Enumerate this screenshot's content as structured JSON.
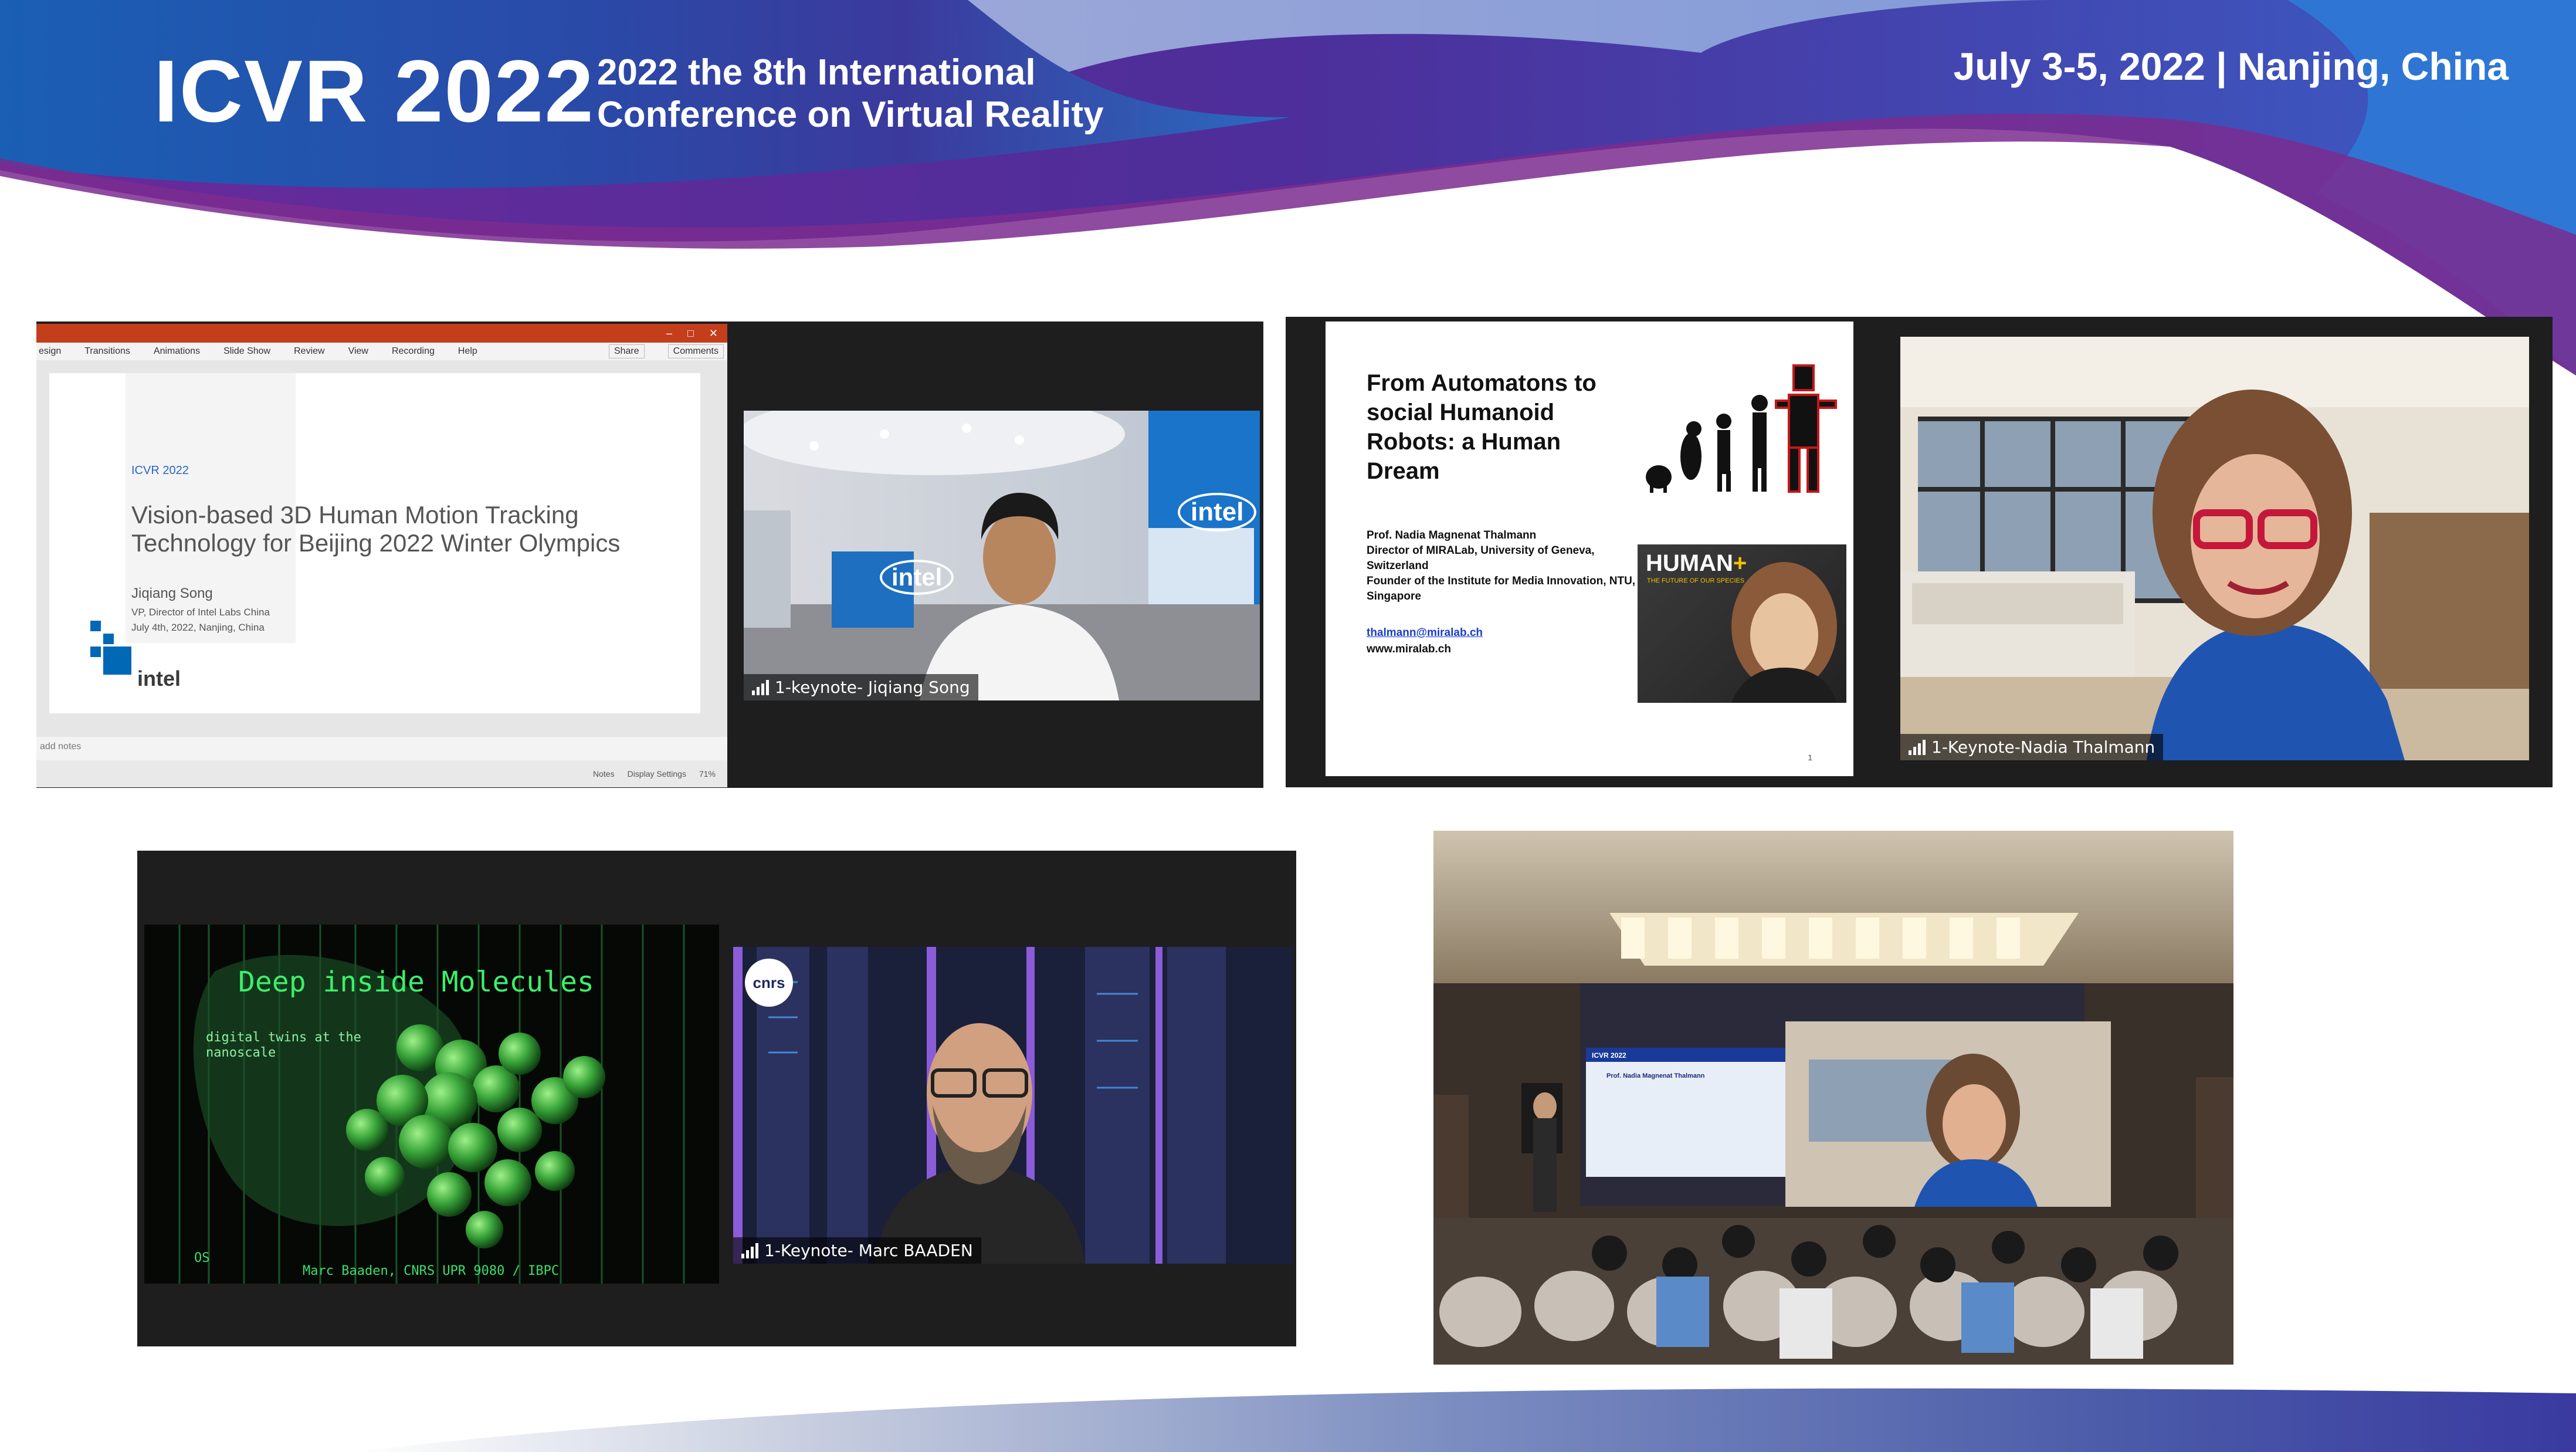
{
  "header": {
    "logo": "ICVR 2022",
    "conference_line1": "2022 the 8th International",
    "conference_line2": "Conference on Virtual Reality",
    "dates_location": "July 3-5, 2022 | Nanjing, China"
  },
  "panel1": {
    "ribbon": [
      "esign",
      "Transitions",
      "Animations",
      "Slide Show",
      "Review",
      "View",
      "Recording",
      "Help"
    ],
    "share": "Share",
    "comments": "Comments",
    "slide": {
      "tag": "ICVR 2022",
      "title": "Vision-based 3D Human Motion Tracking Technology for Beijing 2022 Winter Olympics",
      "author": "Jiqiang Song",
      "role": "VP, Director of Intel Labs China",
      "date": "July 4th, 2022, Nanjing, China",
      "logo": "intel"
    },
    "notes": "add notes",
    "status": [
      "Notes",
      "Display Settings",
      "71%"
    ],
    "speaker_tag": "1-keynote- Jiqiang Song",
    "wall_logo": "intel"
  },
  "panel2": {
    "slide": {
      "title": "From Automatons to social Humanoid Robots: a Human Dream",
      "info": [
        "Prof. Nadia Magnenat Thalmann",
        "Director of MIRALab, University of Geneva, Switzerland",
        "Founder of the Institute for Media Innovation, NTU, Singapore"
      ],
      "email": "thalmann@miralab.ch",
      "web": "www.miralab.ch",
      "book_title": "HUMAN",
      "book_plus": "+",
      "book_sub": "THE FUTURE OF OUR SPECIES",
      "page_no": "1"
    },
    "speaker_tag": "1-Keynote-Nadia Thalmann"
  },
  "panel3": {
    "slide": {
      "title": "Deep inside Molecules",
      "subtitle": "digital twins at the nanoscale",
      "credit": "Marc Baaden, CNRS UPR 9080 / IBPC",
      "corner": "OS"
    },
    "badge": "cnrs",
    "speaker_tag": "1-Keynote- Marc BAADEN"
  },
  "panel4": {
    "screen_title": "ICVR 2022",
    "screen_speaker": "Prof. Nadia Magnenat Thalmann"
  },
  "colors": {
    "header_blue": "#1d5bb0",
    "header_purple": "#5a2a8c",
    "ppt_red": "#c43e1c",
    "intel_blue": "#0068b5",
    "terminal_green": "#3cf06a"
  }
}
